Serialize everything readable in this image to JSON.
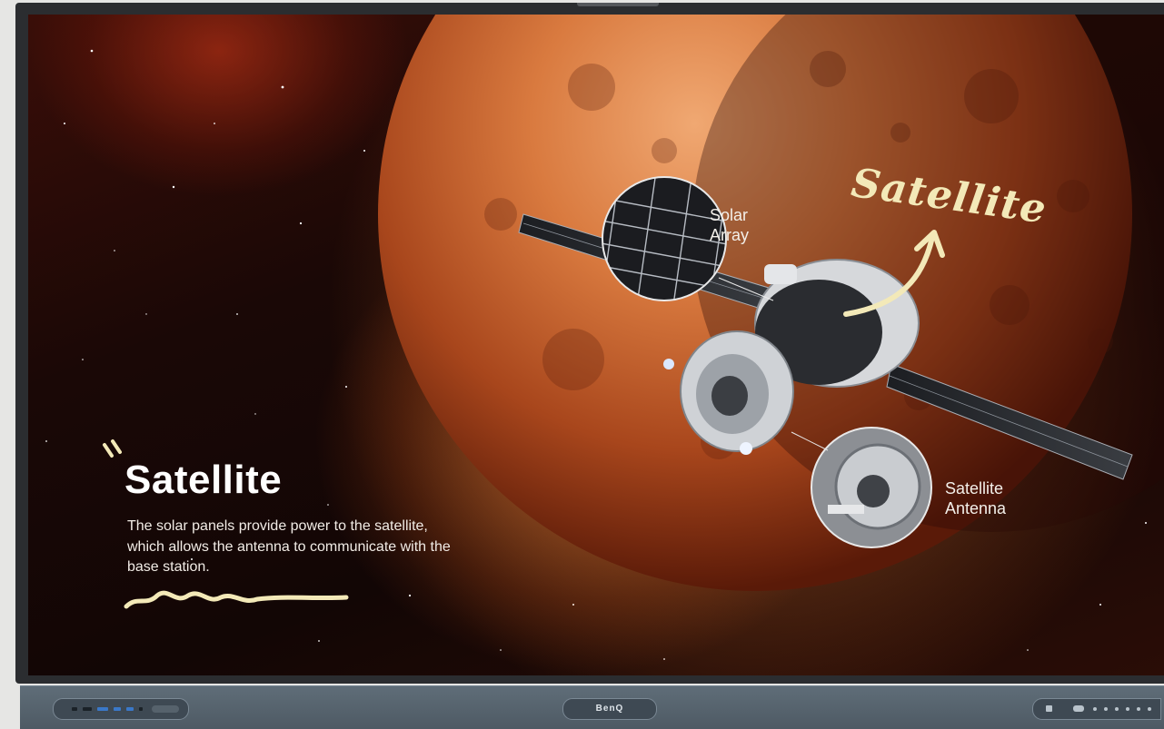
{
  "lesson": {
    "title": "Satellite",
    "body": "The solar panels provide power to the satellite, which allows the antenna to communicate with the base station."
  },
  "annotations": {
    "handwritten_label": "Satellite",
    "solar_callout": "Solar\nArray",
    "antenna_callout": "Satellite\nAntenna"
  },
  "device": {
    "brand": "BenQ"
  },
  "icons": {
    "quote_mark": "quote-marks-icon",
    "underline": "squiggle-underline-icon",
    "arrow": "curved-arrow-icon"
  },
  "colors": {
    "planet": "#c8602a",
    "highlight": "#f3e9b8",
    "text": "#ffffff",
    "bezel": "#2b2d30"
  }
}
